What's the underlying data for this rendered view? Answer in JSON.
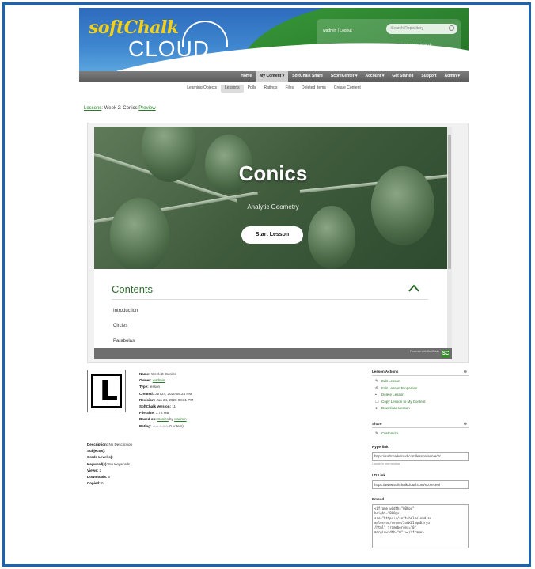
{
  "header": {
    "logo_soft": "softChalk",
    "logo_cloud": "CLOUD",
    "user_links": "wadmin | Logout",
    "search_placeholder": "Search Repository",
    "advanced_search": "Advanced Search"
  },
  "nav": {
    "items": [
      "Home",
      "My Content ▾",
      "SoftChalk Share",
      "ScoreCenter ▾",
      "Account ▾",
      "Get Started",
      "Support",
      "Admin ▾"
    ],
    "active_index": 1
  },
  "subnav": {
    "items": [
      "Learning Objects",
      "Lessons",
      "Polls",
      "Ratings",
      "Files",
      "Deleted Items",
      "Create Content"
    ],
    "active_index": 1
  },
  "breadcrumb": {
    "lessons": "Lessons",
    "sep": ":",
    "name": "Week 2: Conics",
    "preview": "Preview"
  },
  "preview": {
    "title": "Conics",
    "subtitle": "Analytic Geometry",
    "start_button": "Start Lesson",
    "contents_title": "Contents",
    "contents_items": [
      "Introduction",
      "Circles",
      "Parabolas"
    ],
    "powered": "Powered with SoftChalk",
    "sc_badge": "SC"
  },
  "lesson_icon": {
    "letter": "L"
  },
  "details": {
    "name_label": "Name:",
    "name": "Week 2: Conics",
    "owner_label": "Owner:",
    "owner": "wadmin",
    "type_label": "Type:",
    "type": "lesson",
    "created_label": "Created:",
    "created": "Jun 24, 2020 08:24 PM",
    "revision_label": "Revision:",
    "revision": "Jun 24, 2020 08:31 PM",
    "version_label": "SoftChalk Version:",
    "version": "11",
    "filesize_label": "File Size:",
    "filesize": "7.72 MB",
    "based_label": "Based on:",
    "based_item": "Conics",
    "based_by": "by",
    "based_owner": "wadmin",
    "rating_label": "Rating:",
    "rating_stars": "☆☆☆☆☆",
    "rating_votes": "0 vote(s)",
    "description_label": "Description:",
    "description": "No Description",
    "subjects_label": "Subject(s):",
    "subjects": "",
    "grade_label": "Grade Level(s):",
    "grade": "",
    "keywords_label": "Keyword(s):",
    "keywords": "No Keywords",
    "views_label": "Views:",
    "views": "2",
    "downloads_label": "Downloads:",
    "downloads": "0",
    "copied_label": "Copied:",
    "copied": "0"
  },
  "sidebar": {
    "actions_title": "Lesson Actions",
    "toggle": "⊖",
    "actions": [
      "Edit Lesson",
      "Edit Lesson Properties",
      "Delete Lesson",
      "Copy Lesson to My Content",
      "Download Lesson"
    ],
    "share_title": "Share",
    "share_links": [
      "Customize"
    ],
    "hyperlink_label": "Hyperlink",
    "hyperlink_value": "https://softchalkcloud.com/lesson/serve/2c",
    "hyperlink_note": "Launch in new window",
    "lti_label": "LTI Link",
    "lti_value": "https://www.softchalkcloud.com/scorecenl",
    "embed_label": "Embed",
    "embed_code": "<iframe width=\"800px\"\nheight=\"800px\"\nsrc=\"https://softchalkcloud.co\nm/lesson/serve/2oAKOIhqmDSryu\n/html\" frameborder=\"0\"\nmarginwidth=\"0\" ></iframe>"
  }
}
